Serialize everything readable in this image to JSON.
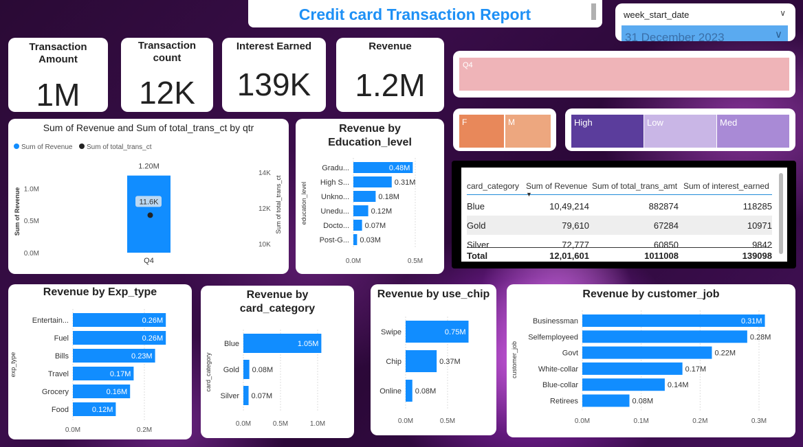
{
  "header": {
    "title": "Credit card Transaction Report"
  },
  "slicer": {
    "label": "week_start_date",
    "value": "31 December 2023"
  },
  "kpis": [
    {
      "title": "Transaction Amount",
      "value": "1M"
    },
    {
      "title": "Transaction count",
      "value": "12K"
    },
    {
      "title": "Interest Earned",
      "value": "139K"
    },
    {
      "title": "Revenue",
      "value": "1.2M"
    }
  ],
  "quarter_tile": {
    "label": "Q4",
    "color": "#efb4b8"
  },
  "gender_tiles": [
    {
      "label": "F",
      "color": "#e8885a"
    },
    {
      "label": "M",
      "color": "#eda77f"
    }
  ],
  "income_tiles": [
    {
      "label": "High",
      "color": "#5b3d9c"
    },
    {
      "label": "Low",
      "color": "#c9b6e6"
    },
    {
      "label": "Med",
      "color": "#a98ad6"
    }
  ],
  "table": {
    "headers": [
      "card_category",
      "Sum of Revenue",
      "Sum of total_trans_amt",
      "Sum of interest_earned"
    ],
    "rows": [
      [
        "Blue",
        "10,49,214",
        "882874",
        "118285"
      ],
      [
        "Gold",
        "79,610",
        "67284",
        "10971"
      ],
      [
        "Silver",
        "72,777",
        "60850",
        "9842"
      ]
    ],
    "total": [
      "Total",
      "12,01,601",
      "1011008",
      "139098"
    ]
  },
  "chart_data": [
    {
      "type": "bar",
      "title": "Sum of Revenue and Sum of total_trans_ct by qtr",
      "legend": [
        "Sum of Revenue",
        "Sum of total_trans_ct"
      ],
      "categories": [
        "Q4"
      ],
      "series": [
        {
          "name": "Sum of Revenue",
          "values": [
            1.2
          ],
          "label": "1.20M",
          "color": "#118dff"
        },
        {
          "name": "Sum of total_trans_ct",
          "values": [
            11.6
          ],
          "label": "11.6K",
          "color": "#222222"
        }
      ],
      "ylabel": "Sum of Revenue",
      "y2label": "Sum of total_trans_ct",
      "yticks": [
        "0.0M",
        "0.5M",
        "1.0M"
      ],
      "y2ticks": [
        "10K",
        "12K",
        "14K"
      ],
      "ylim": [
        0,
        1.25
      ],
      "y2lim": [
        9.5,
        14
      ]
    },
    {
      "type": "bar",
      "title": "Revenue by Education_level",
      "ylabel": "education_level",
      "categories": [
        "Gradu...",
        "High S...",
        "Unkno...",
        "Unedu...",
        "Docto...",
        "Post-G..."
      ],
      "values": [
        0.48,
        0.31,
        0.18,
        0.12,
        0.07,
        0.03
      ],
      "labels": [
        "0.48M",
        "0.31M",
        "0.18M",
        "0.12M",
        "0.07M",
        "0.03M"
      ],
      "xticks": [
        "0.0M",
        "0.5M"
      ],
      "xlim": [
        0,
        0.5
      ]
    },
    {
      "type": "bar",
      "title": "Revenue by Exp_type",
      "ylabel": "exp_type",
      "categories": [
        "Entertain...",
        "Fuel",
        "Bills",
        "Travel",
        "Grocery",
        "Food"
      ],
      "values": [
        0.26,
        0.26,
        0.23,
        0.17,
        0.16,
        0.12
      ],
      "labels": [
        "0.26M",
        "0.26M",
        "0.23M",
        "0.17M",
        "0.16M",
        "0.12M"
      ],
      "xticks": [
        "0.0M",
        "0.2M"
      ],
      "xlim": [
        0,
        0.2
      ]
    },
    {
      "type": "bar",
      "title": "Revenue by card_category",
      "ylabel": "card_category",
      "categories": [
        "Blue",
        "Gold",
        "Silver"
      ],
      "values": [
        1.05,
        0.08,
        0.07
      ],
      "labels": [
        "1.05M",
        "0.08M",
        "0.07M"
      ],
      "xticks": [
        "0.0M",
        "0.5M",
        "1.0M"
      ],
      "xlim": [
        0,
        1.0
      ]
    },
    {
      "type": "bar",
      "title": "Revenue by use_chip",
      "ylabel": "",
      "categories": [
        "Swipe",
        "Chip",
        "Online"
      ],
      "values": [
        0.75,
        0.37,
        0.08
      ],
      "labels": [
        "0.75M",
        "0.37M",
        "0.08M"
      ],
      "xticks": [
        "0.0M",
        "0.5M"
      ],
      "xlim": [
        0,
        0.5
      ]
    },
    {
      "type": "bar",
      "title": "Revenue by customer_job",
      "ylabel": "customer_job",
      "categories": [
        "Businessman",
        "Selfemployeed",
        "Govt",
        "White-collar",
        "Blue-collar",
        "Retirees"
      ],
      "values": [
        0.31,
        0.28,
        0.22,
        0.17,
        0.14,
        0.08
      ],
      "labels": [
        "0.31M",
        "0.28M",
        "0.22M",
        "0.17M",
        "0.14M",
        "0.08M"
      ],
      "xticks": [
        "0.0M",
        "0.1M",
        "0.2M",
        "0.3M"
      ],
      "xlim": [
        0,
        0.3
      ]
    }
  ],
  "colors": {
    "bar": "#118dff",
    "title": "#1e90f5"
  }
}
